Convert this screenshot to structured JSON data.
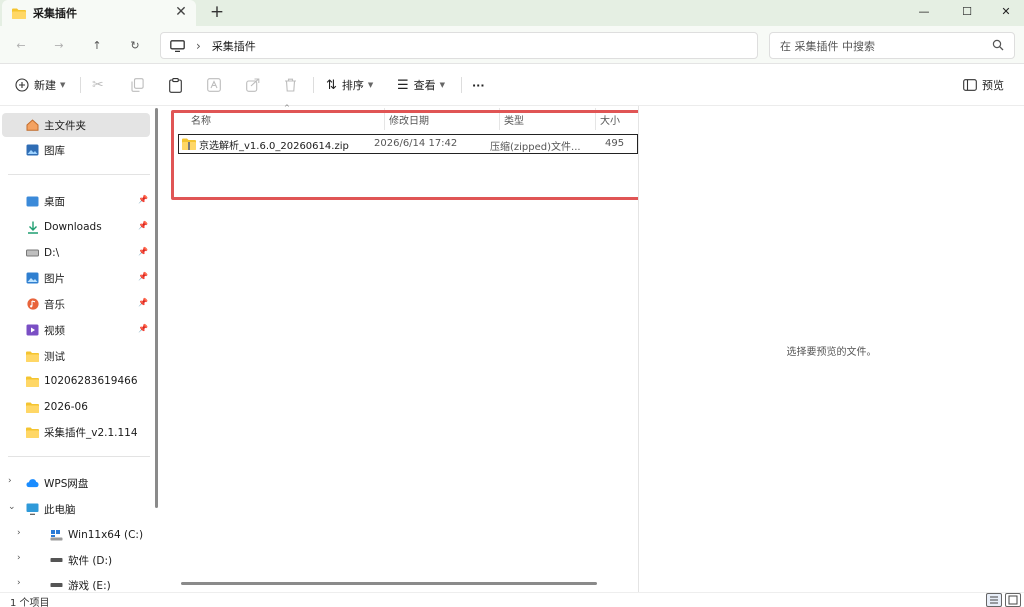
{
  "tab": {
    "title": "采集插件",
    "close_icon": "close-icon",
    "new_tab_icon": "plus-icon"
  },
  "window": {
    "minimize": "—",
    "maximize": "☐",
    "close": "✕"
  },
  "nav": {
    "back": "←",
    "forward": "→",
    "up": "↑",
    "refresh": "↻"
  },
  "address": {
    "separator": "›",
    "crumb": "采集插件"
  },
  "search": {
    "placeholder": "在 采集插件 中搜索"
  },
  "toolbar": {
    "new_label": "新建",
    "sort_label": "排序",
    "view_label": "查看",
    "more_label": "···",
    "preview_label": "预览"
  },
  "sidebar": {
    "items": [
      {
        "label": "主文件夹",
        "icon": "home-icon",
        "selected": true
      },
      {
        "label": "图库",
        "icon": "gallery-icon"
      },
      {
        "label": "桌面",
        "icon": "desktop-icon",
        "pinned": true
      },
      {
        "label": "Downloads",
        "icon": "download-icon",
        "pinned": true
      },
      {
        "label": "D:\\",
        "icon": "drive-icon",
        "pinned": true
      },
      {
        "label": "图片",
        "icon": "pictures-icon",
        "pinned": true
      },
      {
        "label": "音乐",
        "icon": "music-icon",
        "pinned": true
      },
      {
        "label": "视频",
        "icon": "video-icon",
        "pinned": true
      },
      {
        "label": "测试",
        "icon": "folder-icon"
      },
      {
        "label": "10206283619466",
        "icon": "folder-icon"
      },
      {
        "label": "2026-06",
        "icon": "folder-icon"
      },
      {
        "label": "采集插件_v2.1.114",
        "icon": "folder-icon"
      },
      {
        "label": "WPS网盘",
        "icon": "cloud-icon"
      },
      {
        "label": "此电脑",
        "icon": "computer-icon"
      },
      {
        "label": "Win11x64 (C:)",
        "icon": "windows-drive-icon"
      },
      {
        "label": "软件 (D:)",
        "icon": "drive-icon"
      },
      {
        "label": "游戏 (E:)",
        "icon": "drive-icon"
      }
    ]
  },
  "filelist": {
    "columns": [
      "名称",
      "修改日期",
      "类型",
      "大小"
    ],
    "rows": [
      {
        "name": "京选解析_v1.6.0_20260614.zip",
        "modified": "2026/6/14 17:42",
        "type": "压缩(zipped)文件...",
        "size": "495"
      }
    ]
  },
  "preview": {
    "message": "选择要预览的文件。"
  },
  "status": {
    "count": "1 个项目"
  },
  "colors": {
    "titlebar": "#e5efe3",
    "highlight": "#e05555",
    "folder": "#f4c430"
  }
}
